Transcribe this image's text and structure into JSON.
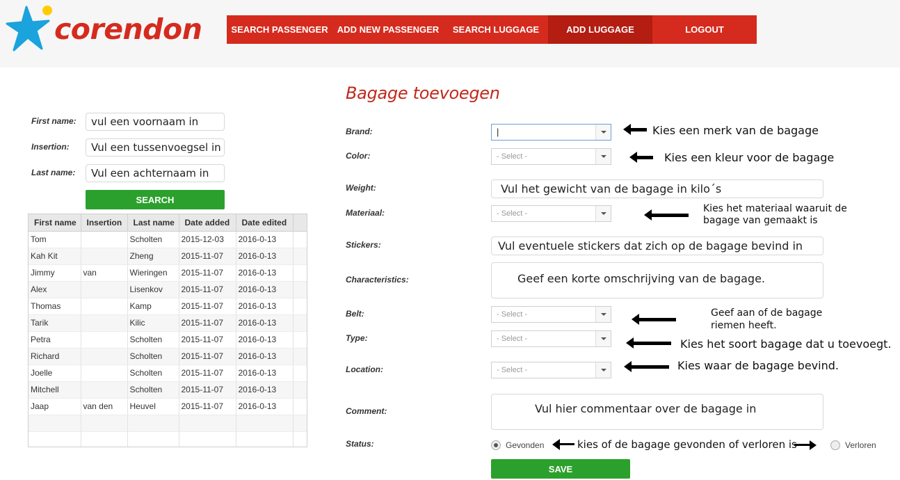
{
  "brand": {
    "name": "corendon"
  },
  "nav": {
    "items": [
      {
        "label": "SEARCH PASSENGER"
      },
      {
        "label": "ADD NEW PASSENGER"
      },
      {
        "label": "SEARCH LUGGAGE"
      },
      {
        "label": "ADD LUGGAGE"
      },
      {
        "label": "LOGOUT"
      }
    ],
    "active": "ADD LUGGAGE"
  },
  "search": {
    "first_name_label": "First name:",
    "first_name_value": "vul een voornaam in",
    "insertion_label": "Insertion:",
    "insertion_value": "Vul een tussenvoegsel in",
    "last_name_label": "Last name:",
    "last_name_value": "Vul een achternaam in",
    "button_label": "SEARCH"
  },
  "table": {
    "columns": [
      "First name",
      "Insertion",
      "Last name",
      "Date added",
      "Date edited"
    ],
    "rows": [
      [
        "Tom",
        "",
        "Scholten",
        "2015-12-03",
        "2016-0-13"
      ],
      [
        "Kah Kit",
        "",
        "Zheng",
        "2015-11-07",
        "2016-0-13"
      ],
      [
        "Jimmy",
        "van",
        "Wieringen",
        "2015-11-07",
        "2016-0-13"
      ],
      [
        "Alex",
        "",
        "Lisenkov",
        "2015-11-07",
        "2016-0-13"
      ],
      [
        "Thomas",
        "",
        "Kamp",
        "2015-11-07",
        "2016-0-13"
      ],
      [
        "Tarik",
        "",
        "Kilic",
        "2015-11-07",
        "2016-0-13"
      ],
      [
        "Petra",
        "",
        "Scholten",
        "2015-11-07",
        "2016-0-13"
      ],
      [
        "Richard",
        "",
        "Scholten",
        "2015-11-07",
        "2016-0-13"
      ],
      [
        "Joelle",
        "",
        "Scholten",
        "2015-11-07",
        "2016-0-13"
      ],
      [
        "Mitchell",
        "",
        "Scholten",
        "2015-11-07",
        "2016-0-13"
      ],
      [
        "Jaap",
        "van den",
        "Heuvel",
        "2015-11-07",
        "2016-0-13"
      ]
    ]
  },
  "form": {
    "title": "Bagage toevoegen",
    "brand_label": "Brand:",
    "brand_value": "|",
    "brand_note": "Kies een merk van de bagage",
    "color_label": "Color:",
    "color_value": "- Select -",
    "color_note": "Kies een kleur voor de bagage",
    "weight_label": "Weight:",
    "weight_value": "Vul het gewicht van de bagage in kilo´s",
    "material_label": "Materiaal:",
    "material_value": "- Select -",
    "material_note_1": "Kies het materiaal waaruit de",
    "material_note_2": "bagage van gemaakt is",
    "stickers_label": "Stickers:",
    "stickers_value": "Vul eventuele stickers dat zich op de bagage bevind in",
    "characteristics_label": "Characteristics:",
    "characteristics_value": "Geef een korte omschrijving van de bagage.",
    "belt_label": "Belt:",
    "belt_value": "- Select -",
    "belt_note_1": "Geef aan of de bagage",
    "belt_note_2": "riemen heeft.",
    "type_label": "Type:",
    "type_value": "- Select -",
    "type_note": "Kies het soort bagage dat u toevoegt.",
    "location_label": "Location:",
    "location_value": "- Select -",
    "location_note": "Kies waar de bagage bevind.",
    "comment_label": "Comment:",
    "comment_value": "Vul hier commentaar over de bagage in",
    "status_label": "Status:",
    "status_found": "Gevonden",
    "status_lost": "Verloren",
    "status_note": "kies of de bagage gevonden of verloren is",
    "save_label": "SAVE"
  },
  "colors": {
    "accent": "#d52b1e",
    "green": "#2ca02c",
    "logo_blue": "#1aa3dc",
    "logo_yellow": "#ffcc00"
  }
}
